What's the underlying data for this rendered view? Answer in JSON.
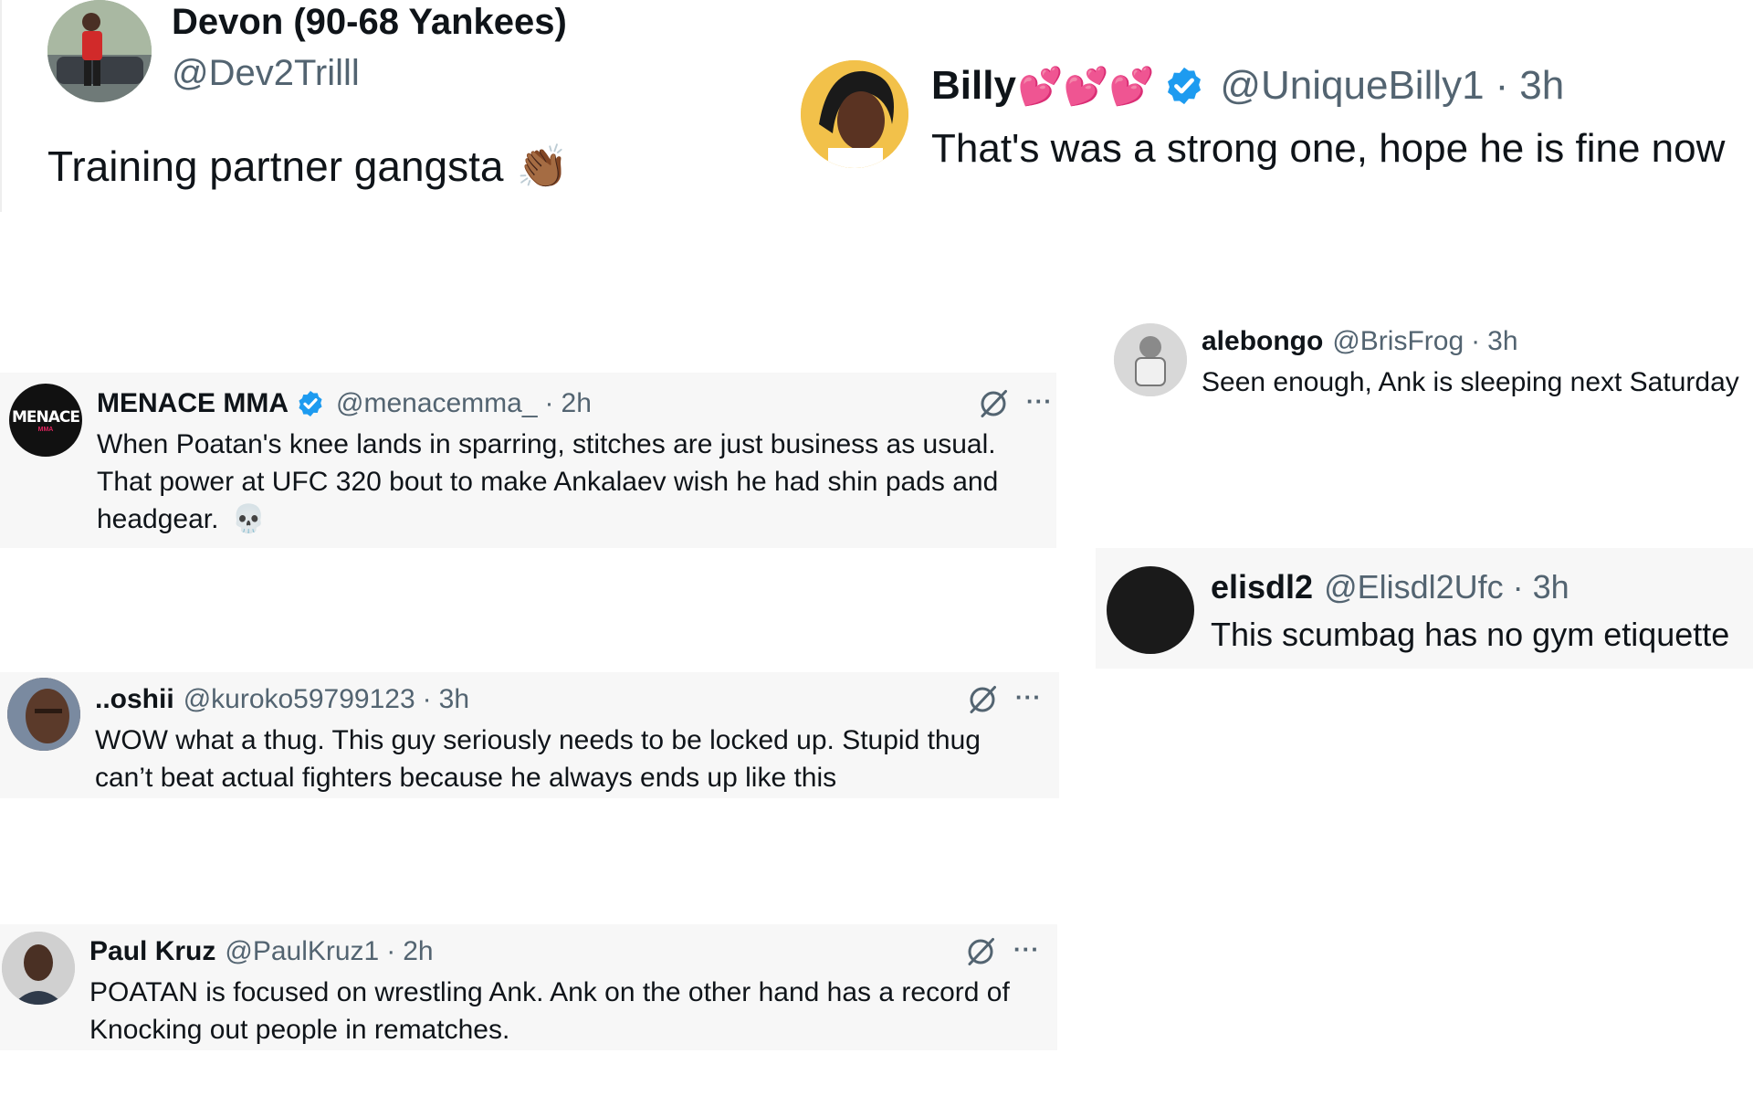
{
  "tweets": {
    "devon": {
      "name": "Devon (90-68 Yankees)",
      "handle": "@Dev2Trilll",
      "text": "Training partner gangsta",
      "emoji": "👏🏾"
    },
    "billy": {
      "name": "Billy",
      "hearts": "💕💕💕",
      "handle": "@UniqueBilly1",
      "dot": "·",
      "time": "3h",
      "text": "That's was a strong one, hope he is fine now"
    },
    "alebongo": {
      "name": "alebongo",
      "handle": "@BrisFrog",
      "dot": "·",
      "time": "3h",
      "text": "Seen enough, Ank is sleeping next Saturday"
    },
    "menace": {
      "name": "MENACE MMA",
      "avatar_text": "MENACE",
      "avatar_sub": "MMA",
      "handle": "@menacemma_",
      "dot": "·",
      "time": "2h",
      "text": "When Poatan's knee lands in sparring, stitches are just business as usual. That power at UFC 320 bout to make Ankalaev wish he had shin pads and headgear.",
      "emoji": "💀",
      "more": "···"
    },
    "elisdl2": {
      "name": "elisdl2",
      "handle": "@Elisdl2Ufc",
      "dot": "·",
      "time": "3h",
      "text": "This scumbag has no gym etiquette"
    },
    "oshii": {
      "name": "..oshii",
      "handle": "@kuroko59799123",
      "dot": "·",
      "time": "3h",
      "text": "WOW what a thug. This guy seriously needs to be locked up. Stupid thug can’t beat actual fighters because he always ends up like this",
      "more": "···"
    },
    "paul": {
      "name": "Paul Kruz",
      "handle": "@PaulKruz1",
      "dot": "·",
      "time": "2h",
      "text": "POATAN is focused on wrestling Ank. Ank on the other hand has a record of Knocking out people in rematches.",
      "more": "···"
    }
  },
  "colors": {
    "verified_blue": "#1d9bf0",
    "handle_gray": "#536471",
    "card_gray": "#f7f7f7",
    "heart_red": "#e0245e"
  },
  "icons": [
    "verified-icon",
    "grok-icon",
    "more-icon"
  ]
}
